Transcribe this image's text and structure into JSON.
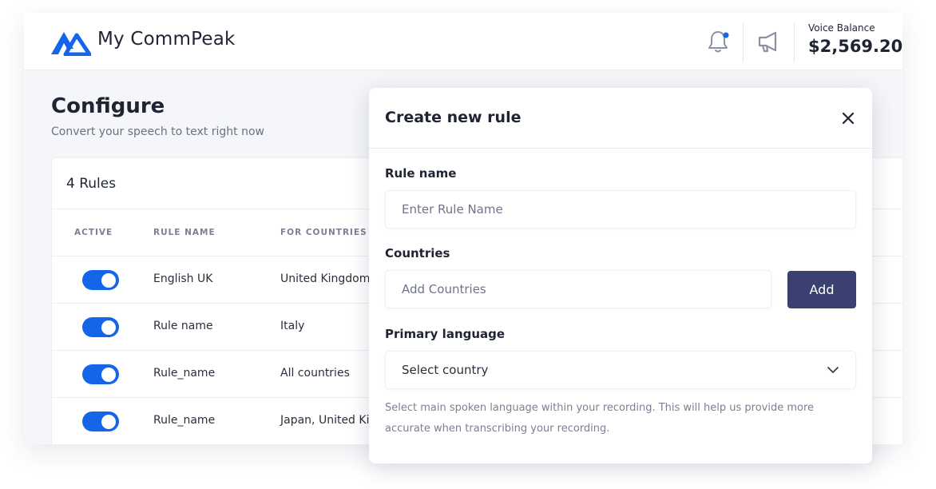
{
  "header": {
    "brand": "My CommPeak",
    "balance_label": "Voice Balance",
    "balance_value": "$2,569.20",
    "icons": [
      "logo-icon",
      "bell-icon",
      "megaphone-icon"
    ],
    "accent_color": "#1565e8"
  },
  "page": {
    "title": "Configure",
    "subtitle": "Convert your speech to text right now"
  },
  "rules": {
    "count_label": "4 Rules",
    "columns": [
      "ACTIVE",
      "RULE NAME",
      "FOR COUNTRIES"
    ],
    "rows": [
      {
        "active": true,
        "name": "English UK",
        "countries": "United Kingdom,"
      },
      {
        "active": true,
        "name": "Rule name",
        "countries": "Italy"
      },
      {
        "active": true,
        "name": "Rule_name",
        "countries": "All countries"
      },
      {
        "active": true,
        "name": "Rule_name",
        "countries": "Japan, United Kin"
      }
    ]
  },
  "modal": {
    "title": "Create new rule",
    "rule_name_label": "Rule name",
    "rule_name_placeholder": "Enter Rule Name",
    "countries_label": "Countries",
    "countries_placeholder": "Add Countries",
    "add_label": "Add",
    "primary_language_label": "Primary language",
    "primary_language_value": "Select country",
    "helper_text": "Select main spoken language within your recording. This will help us provide more accurate when transcribing your recording."
  }
}
